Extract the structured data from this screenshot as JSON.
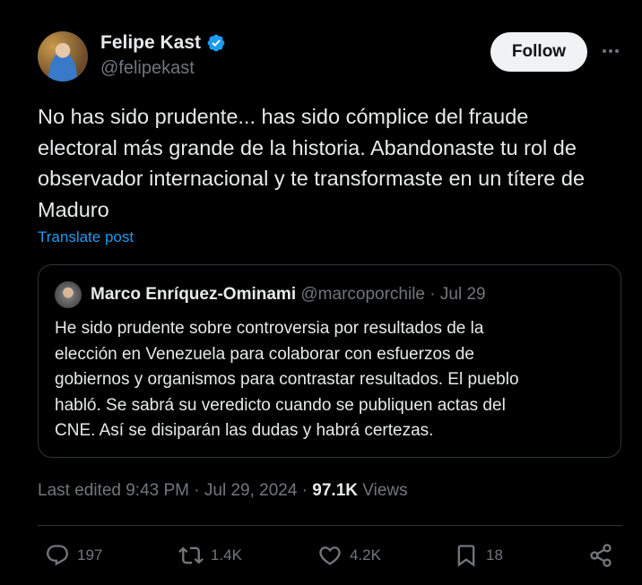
{
  "author": {
    "name": "Felipe Kast",
    "handle": "@felipekast"
  },
  "follow_label": "Follow",
  "tweet": {
    "lines": [
      "No has sido prudente... has sido cómplice del fraude",
      "electoral más grande de la historia. Abandonaste tu rol de",
      "observador internacional y te transformaste en un títere de",
      "Maduro"
    ],
    "translate": "Translate post"
  },
  "quote": {
    "name": "Marco Enríquez-Ominami",
    "handle_date": "@marcoporchile · Jul 29",
    "lines": [
      "He sido prudente sobre controversia por resultados de la",
      "elección en Venezuela para colaborar con esfuerzos de",
      "gobiernos y organismos para contrastar resultados. El pueblo",
      "habló. Se sabrá su veredicto cuando se publiquen actas del",
      "CNE. Así se disiparán las dudas y habrá certezas."
    ]
  },
  "meta": {
    "edited": "Last edited 9:43 PM · Jul 29, 2024 · ",
    "views_count": "97.1K",
    "views_label": " Views"
  },
  "actions": {
    "replies": "197",
    "reposts": "1.4K",
    "likes": "4.2K",
    "bookmarks": "18"
  },
  "colors": {
    "background": "#000000",
    "text": "#e7e9ea",
    "muted": "#71767b",
    "link": "#1d9bf0",
    "verified": "#1d9bf0"
  }
}
